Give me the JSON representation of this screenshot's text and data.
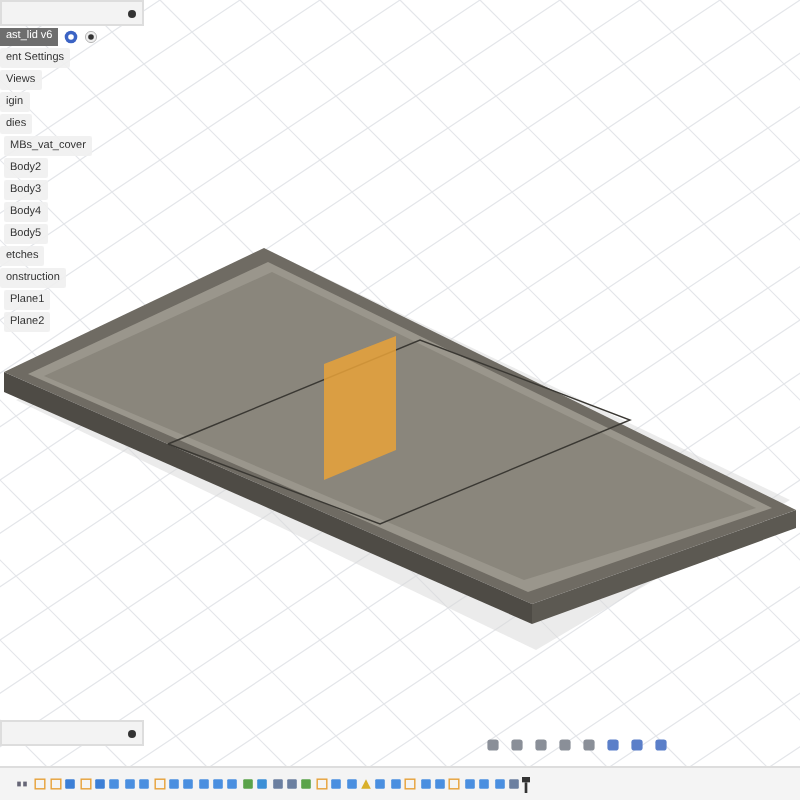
{
  "browser": {
    "document": "ast_lid v6",
    "items": [
      {
        "label": "ent Settings"
      },
      {
        "label": "Views"
      },
      {
        "label": "igin"
      },
      {
        "label": "dies",
        "children": [
          {
            "label": "MBs_vat_cover"
          },
          {
            "label": "Body2"
          },
          {
            "label": "Body3"
          },
          {
            "label": "Body4"
          },
          {
            "label": "Body5"
          }
        ]
      },
      {
        "label": "etches"
      },
      {
        "label": "onstruction",
        "children": [
          {
            "label": "Plane1"
          },
          {
            "label": "Plane2"
          }
        ]
      }
    ]
  },
  "timeline": {
    "features": [
      {
        "kind": "sketch"
      },
      {
        "kind": "sketch"
      },
      {
        "kind": "extrude"
      },
      {
        "kind": "sketch"
      },
      {
        "kind": "extrude"
      },
      {
        "kind": "body"
      },
      {
        "kind": "body"
      },
      {
        "kind": "body"
      },
      {
        "kind": "sketch"
      },
      {
        "kind": "body"
      },
      {
        "kind": "body"
      },
      {
        "kind": "body"
      },
      {
        "kind": "body"
      },
      {
        "kind": "body"
      },
      {
        "kind": "fillet"
      },
      {
        "kind": "hole"
      },
      {
        "kind": "combine"
      },
      {
        "kind": "combine"
      },
      {
        "kind": "fillet"
      },
      {
        "kind": "sketch"
      },
      {
        "kind": "body"
      },
      {
        "kind": "body"
      },
      {
        "kind": "warn"
      },
      {
        "kind": "body"
      },
      {
        "kind": "body"
      },
      {
        "kind": "sketch"
      },
      {
        "kind": "body"
      },
      {
        "kind": "revolve"
      },
      {
        "kind": "sketch"
      },
      {
        "kind": "body"
      },
      {
        "kind": "body"
      },
      {
        "kind": "body"
      },
      {
        "kind": "combine"
      }
    ]
  }
}
